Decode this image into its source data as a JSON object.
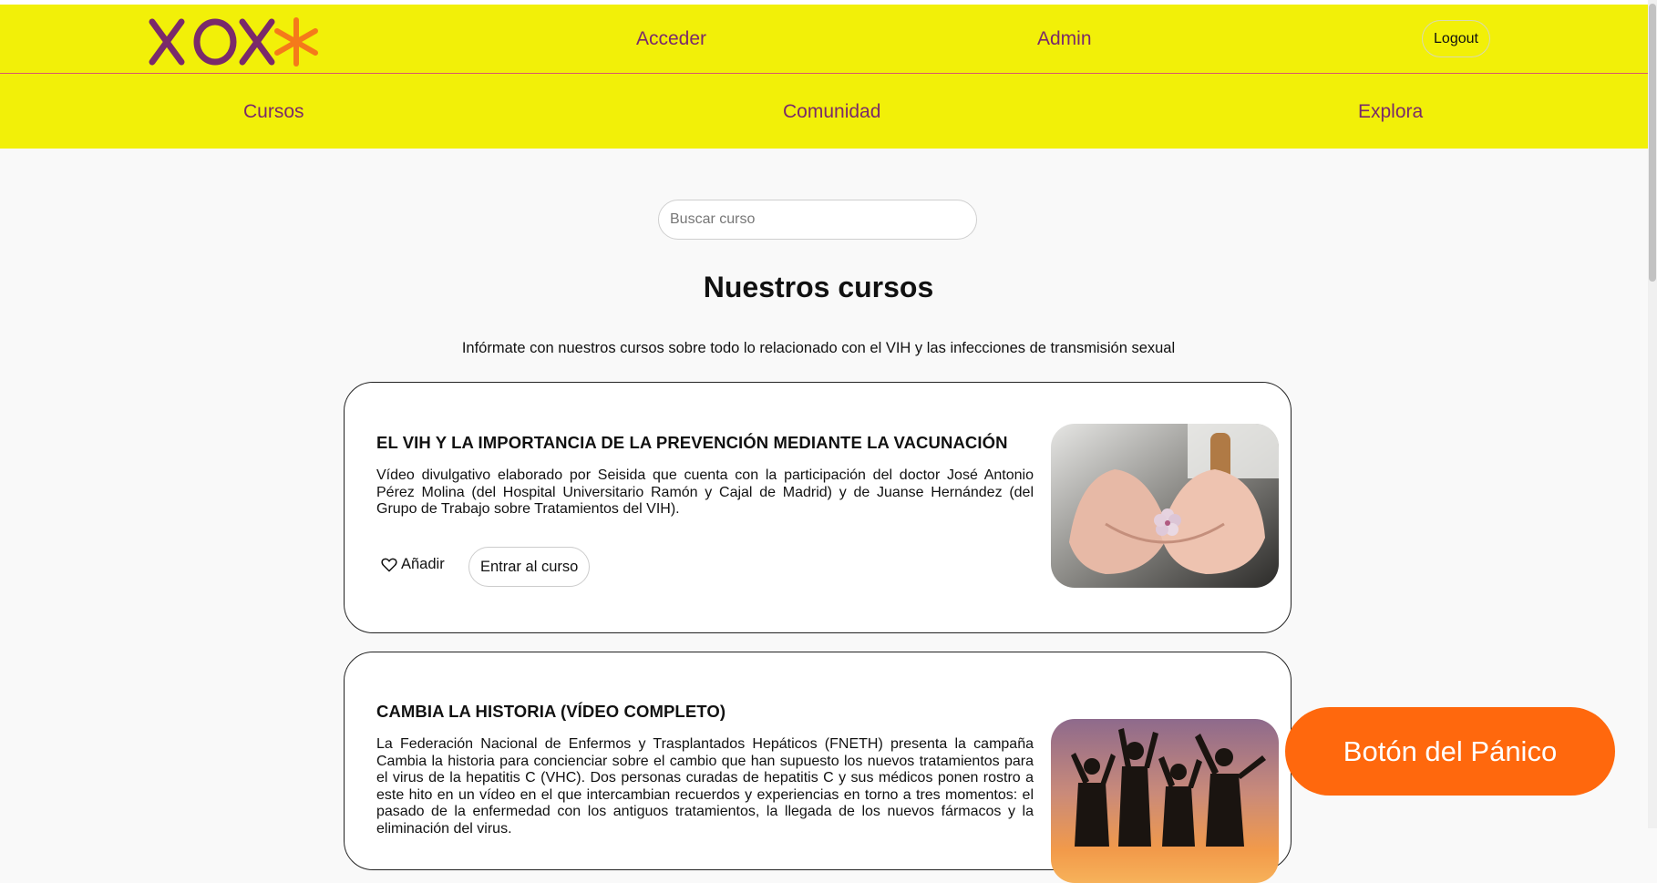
{
  "brand": {
    "logo_text": "XOX*"
  },
  "header": {
    "top_nav": [
      {
        "label": "Acceder"
      },
      {
        "label": "Admin"
      }
    ],
    "logout_label": "Logout",
    "main_nav": [
      {
        "label": "Cursos"
      },
      {
        "label": "Comunidad"
      },
      {
        "label": "Explora"
      }
    ]
  },
  "search": {
    "placeholder": "Buscar curso",
    "value": ""
  },
  "main": {
    "title": "Nuestros cursos",
    "subtitle": "Infórmate con nuestros cursos sobre todo lo relacionado con el VIH y las infecciones de transmisión sexual"
  },
  "courses": [
    {
      "title": "EL VIH Y LA IMPORTANCIA DE LA PREVENCIÓN MEDIANTE LA VACUNACIÓN",
      "description": "Vídeo divulgativo elaborado por Seisida que cuenta con la participación del doctor José Antonio Pérez Molina (del Hospital Universitario Ramón y Cajal de Madrid) y de Juanse Hernández (del Grupo de Trabajo sobre Tratamientos del VIH).",
      "fav_label": "Añadir",
      "enter_label": "Entrar al curso",
      "image": "hands-holding-flower-photo"
    },
    {
      "title": "CAMBIA LA HISTORIA (VÍDEO COMPLETO)",
      "description": "La Federación Nacional de Enfermos y Trasplantados Hepáticos (FNETH) presenta la campaña Cambia la historia para concienciar sobre el cambio que han supuesto los nuevos tratamientos para el virus de la hepatitis C (VHC). Dos personas curadas de hepatitis C y sus médicos ponen rostro a este hito en un vídeo en el que intercambian recuerdos y experiencias en torno a tres momentos: el pasado de la enfermedad con los antiguos tratamientos, la llegada de los nuevos fármacos y la eliminación del virus.",
      "image": "people-silhouettes-sunset-photo"
    }
  ],
  "panic_button": {
    "label": "Botón del Pánico"
  },
  "colors": {
    "header_bg": "#f2f008",
    "nav_text": "#7a2a6a",
    "logo_purple": "#7a2a6a",
    "logo_orange": "#f57a1a",
    "panic_bg": "#ff680d"
  },
  "icons": [
    "heart-icon"
  ]
}
